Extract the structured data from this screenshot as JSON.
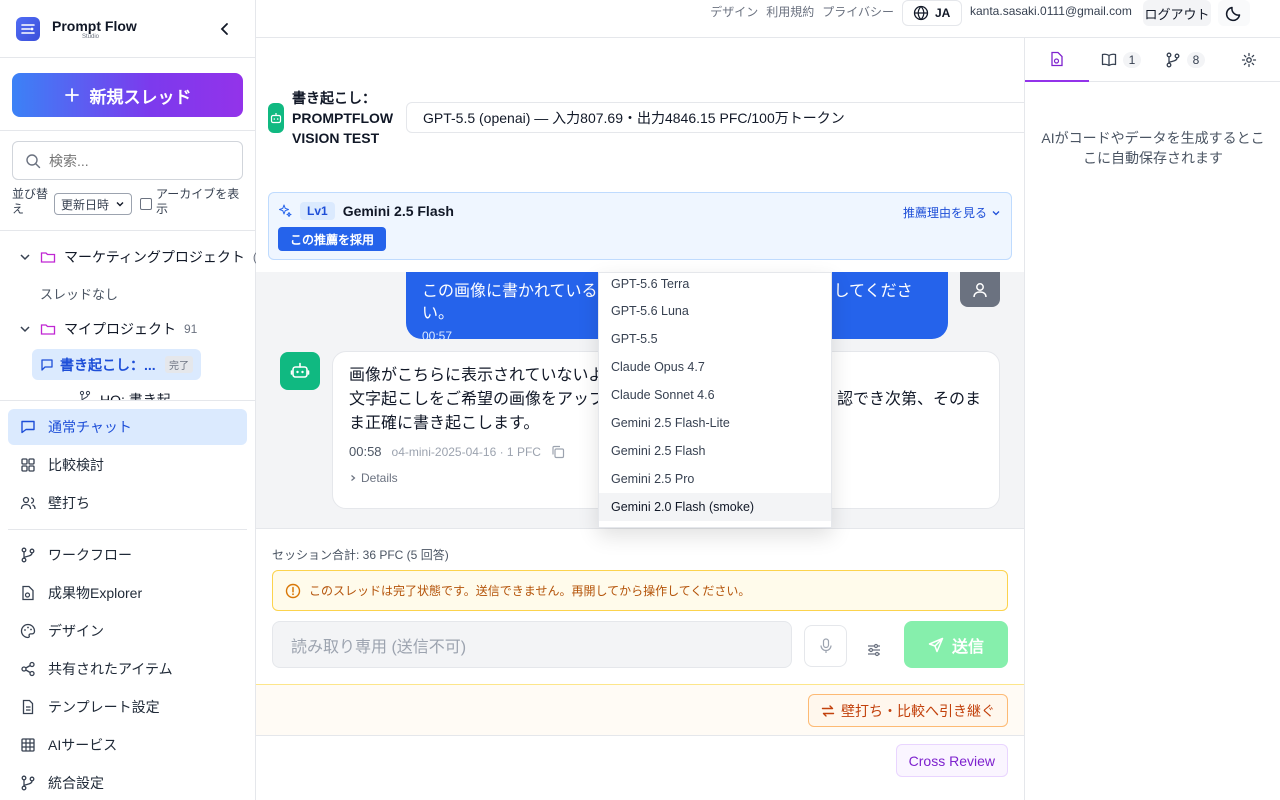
{
  "brand": {
    "title": "Prompt Flow",
    "subtitle": "Studio"
  },
  "sidebar": {
    "new_thread": "新規スレッド",
    "search_placeholder": "検索...",
    "sort_label": "並び替え",
    "sort_value": "更新日時",
    "archive_label": "アーカイブを表示",
    "tree": {
      "project1": {
        "name": "マーケティングプロジェクト",
        "count": "("
      },
      "no_threads": "スレッドなし",
      "project2": {
        "name": "マイプロジェクト",
        "count": "91"
      },
      "active_thread": {
        "label": "書き起こし：...",
        "badge": "完了"
      },
      "next_thread": "HQ: 書き起"
    },
    "nav": [
      {
        "label": "通常チャット",
        "icon": "chat-icon"
      },
      {
        "label": "比較検討",
        "icon": "grid-icon"
      },
      {
        "label": "壁打ち",
        "icon": "users-icon"
      },
      {
        "label": "ワークフロー",
        "icon": "branch-icon"
      },
      {
        "label": "成果物Explorer",
        "icon": "file-icon"
      },
      {
        "label": "デザイン",
        "icon": "palette-icon"
      },
      {
        "label": "共有されたアイテム",
        "icon": "share-icon"
      },
      {
        "label": "テンプレート設定",
        "icon": "document-icon"
      },
      {
        "label": "AIサービス",
        "icon": "table-icon"
      },
      {
        "label": "統合設定",
        "icon": "branch-icon"
      }
    ]
  },
  "topbar": {
    "links": [
      "デザイン",
      "利用規約",
      "プライバシー"
    ],
    "lang": "JA",
    "email": "kanta.sasaki.0111@gmail.com",
    "logout": "ログアウト"
  },
  "thread": {
    "title_line1": "書き起こし：",
    "title_line2": "PROMPTFLOW",
    "title_line3": "VISION TEST",
    "model_selected": "GPT-5.5 (openai) — 入力807.69・出力4846.15 PFC/100万トークン"
  },
  "recommendation": {
    "level": "Lv1",
    "model": "Gemini 2.5 Flash",
    "adopt": "この推薦を採用",
    "reason_link": "推薦理由を見る"
  },
  "messages": {
    "user": {
      "text": "この画像に書かれている",
      "text_tail": "してください。",
      "time": "00:57"
    },
    "bot": {
      "line1": "画像がこちらに表示されていないよ",
      "line2_head": "文字起こしをご希望の画像をアップ",
      "line2_tail": "認でき次第、そのま",
      "line3": "ま正確に書き起こします。",
      "time": "00:58",
      "meta": "o4-mini-2025-04-16 · 1 PFC",
      "details": "Details"
    }
  },
  "model_dropdown": [
    "GPT-5.6 Terra",
    "GPT-5.6 Luna",
    "GPT-5.5",
    "Claude Opus 4.7",
    "Claude Sonnet 4.6",
    "Gemini 2.5 Flash-Lite",
    "Gemini 2.5 Flash",
    "Gemini 2.5 Pro",
    "Gemini 2.0 Flash (smoke)"
  ],
  "compose": {
    "session": "セッション合計: 36 PFC (5 回答)",
    "warning": "このスレッドは完了状態です。送信できません。再開してから操作してください。",
    "placeholder": "読み取り専用 (送信不可)",
    "send": "送信",
    "continue": "壁打ち・比較へ引き継ぐ",
    "cross_review": "Cross Review"
  },
  "right_panel": {
    "tab_counts": {
      "book": "1",
      "branch": "8"
    },
    "note": "AIがコードやデータを生成するとここに自動保存されます"
  },
  "colors": {
    "accent": "#2563eb",
    "brand_gradient_end": "#9333ea",
    "bot": "#10b981"
  }
}
